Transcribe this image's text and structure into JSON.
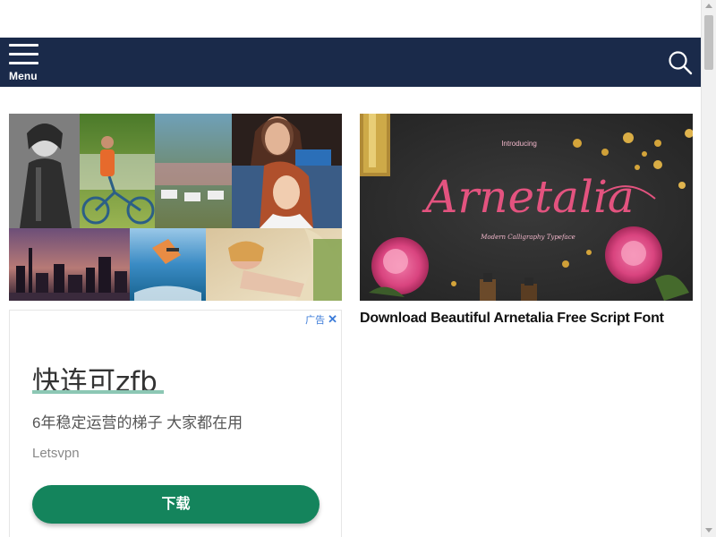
{
  "navbar": {
    "background": "#1a2a4a",
    "menu_icon": "hamburger-menu-icon",
    "menu_label": "Menu",
    "search_icon": "search-icon"
  },
  "posts": [
    {
      "image": "photo-collage",
      "title": ""
    },
    {
      "image": "arnetalia-font-preview",
      "image_text_intro": "Introducing",
      "image_text_name": "Arnetalia",
      "image_text_sub": "Modern Calligraphy Typeface",
      "title": "Download Beautiful Arnetalia Free Script Font"
    }
  ],
  "ad": {
    "badge": "广告",
    "close_icon": "close-icon",
    "title": "快连可zfb",
    "subtitle": "6年稳定运营的梯子 大家都在用",
    "brand": "Letsvpn",
    "cta": "下载",
    "cta_color": "#14845c",
    "underline_color": "#8cc7b4"
  },
  "colors": {
    "navbar": "#1a2a4a",
    "ad_link": "#3b7bd8"
  }
}
